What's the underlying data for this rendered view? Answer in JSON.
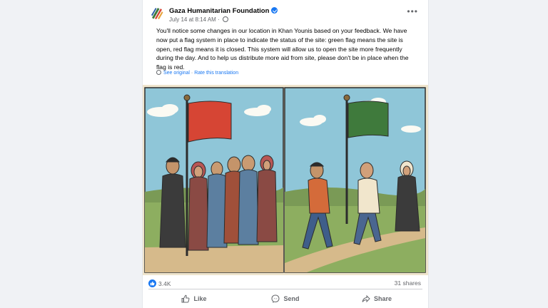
{
  "post": {
    "page_name": "Gaza Humanitarian Foundation",
    "timestamp": "July 14 at 8:14 AM",
    "more_icon": "•••",
    "text": "You'll notice some changes in our location in Khan Younis based on your feedback. We have now put a flag system in place to indicate the status of the site: green flag means the site is open, red flag means it is closed. This system will allow us to open the site more frequently during the day. And to help us distribute more aid from site, please don't be in place when the flag is red.",
    "see_original": "See original",
    "translation_separator": "·",
    "rate_translation": "Rate this translation"
  },
  "stats": {
    "reaction_count": "3.4K",
    "shares": "31 shares"
  },
  "actions": {
    "like": "Like",
    "send": "Send",
    "share": "Share"
  },
  "colors": {
    "facebook_blue": "#1877f2",
    "red_flag": "#d64534",
    "green_flag": "#3f7a3c"
  }
}
